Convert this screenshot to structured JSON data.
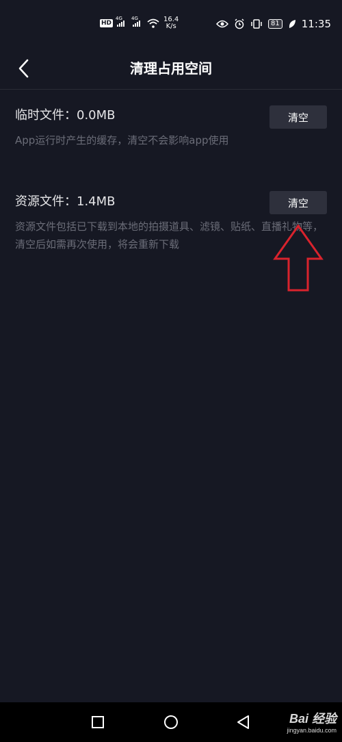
{
  "status_bar": {
    "hd": "HD",
    "signal_1": "4G",
    "signal_2": "4G",
    "speed_value": "16.4",
    "speed_unit": "K/s",
    "battery": "81",
    "time": "11:35"
  },
  "header": {
    "title": "清理占用空间"
  },
  "sections": [
    {
      "title": "临时文件：0.0MB",
      "description": "App运行时产生的缓存，清空不会影响app使用",
      "button_label": "清空"
    },
    {
      "title": "资源文件：1.4MB",
      "description": "资源文件包括已下载到本地的拍摄道具、滤镜、贴纸、直播礼物等，清空后如需再次使用，将会重新下载",
      "button_label": "清空"
    }
  ],
  "watermark": {
    "main": "Bai 经验",
    "sub": "jingyan.baidu.com"
  },
  "colors": {
    "background": "#161823",
    "button_bg": "#2e303c",
    "annotation_arrow": "#d9232d"
  }
}
